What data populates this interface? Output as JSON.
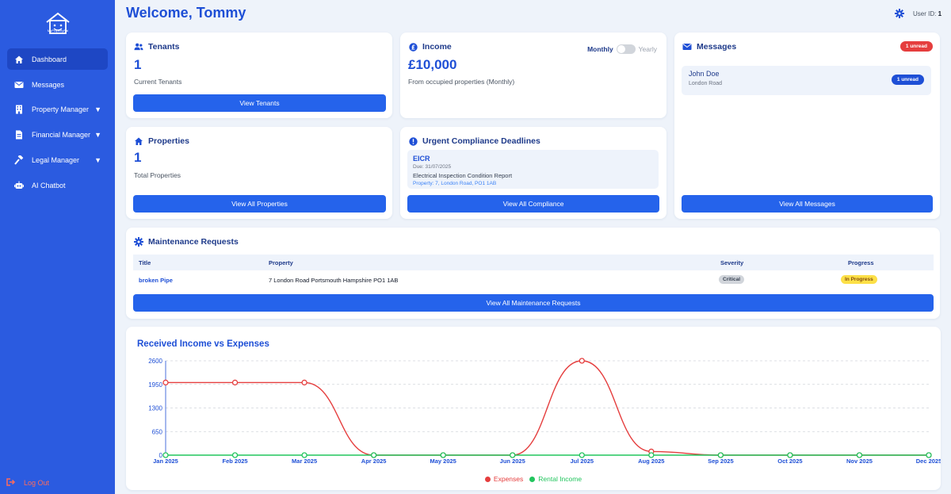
{
  "brand": {
    "logo_text": "MyPropertyPal"
  },
  "sidebar": {
    "items": [
      {
        "label": "Dashboard",
        "icon": "home-icon"
      },
      {
        "label": "Messages",
        "icon": "envelope-icon"
      },
      {
        "label": "Property Manager",
        "icon": "building-icon"
      },
      {
        "label": "Financial Manager",
        "icon": "document-icon"
      },
      {
        "label": "Legal Manager",
        "icon": "gavel-icon"
      },
      {
        "label": "AI Chatbot",
        "icon": "robot-icon"
      }
    ],
    "caret": "▼",
    "logout": "Log Out"
  },
  "header": {
    "title": "Welcome, Tommy",
    "user_id_label": "User ID:",
    "user_id_value": "1"
  },
  "tenants": {
    "title": "Tenants",
    "count": "1",
    "sub": "Current Tenants",
    "button": "View Tenants"
  },
  "income": {
    "title": "Income",
    "amount": "£10,000",
    "sub": "From occupied properties (Monthly)",
    "toggle_left": "Monthly",
    "toggle_right": "Yearly"
  },
  "messages": {
    "title": "Messages",
    "unread_badge": "1 unread",
    "item": {
      "name": "John Doe",
      "sub": "London Road",
      "badge": "1 unread"
    },
    "button": "View All Messages"
  },
  "properties": {
    "title": "Properties",
    "count": "1",
    "sub": "Total Properties",
    "button": "View All Properties"
  },
  "compliance": {
    "title": "Urgent Compliance Deadlines",
    "item": {
      "title": "EICR",
      "due": "Due: 31/07/2025",
      "name": "Electrical Inspection Condition Report",
      "property": "Property: 7, London Road, PO1 1AB"
    },
    "button": "View All Compliance"
  },
  "maintenance": {
    "title": "Maintenance Requests",
    "headers": [
      "Title",
      "Property",
      "Severity",
      "Progress"
    ],
    "row": {
      "title": "broken Pipe",
      "property": "7 London Road Portsmouth Hampshire PO1 1AB",
      "severity": "Critical",
      "progress": "In Progress"
    },
    "button": "View All Maintenance Requests"
  },
  "colors": {
    "accent": "#2563eb",
    "sidebar": "#2b5be0",
    "expenses": "#e53e3e",
    "income": "#22c55e"
  },
  "chart_data": {
    "type": "line",
    "title": "Received Income vs Expenses",
    "categories": [
      "Jan 2025",
      "Feb 2025",
      "Mar 2025",
      "Apr 2025",
      "May 2025",
      "Jun 2025",
      "Jul 2025",
      "Aug 2025",
      "Sep 2025",
      "Oct 2025",
      "Nov 2025",
      "Dec 2025"
    ],
    "series": [
      {
        "name": "Expenses",
        "color": "#e53e3e",
        "values": [
          2000,
          2000,
          2000,
          0,
          0,
          0,
          2600,
          100,
          0,
          0,
          0,
          0
        ]
      },
      {
        "name": "Rental Income",
        "color": "#22c55e",
        "values": [
          0,
          0,
          0,
          0,
          0,
          0,
          0,
          0,
          0,
          0,
          0,
          0
        ]
      }
    ],
    "yticks": [
      "0",
      "650",
      "1300",
      "1950",
      "2600"
    ],
    "ylim": [
      0,
      2600
    ],
    "grid": true,
    "legend": "bottom-center"
  }
}
